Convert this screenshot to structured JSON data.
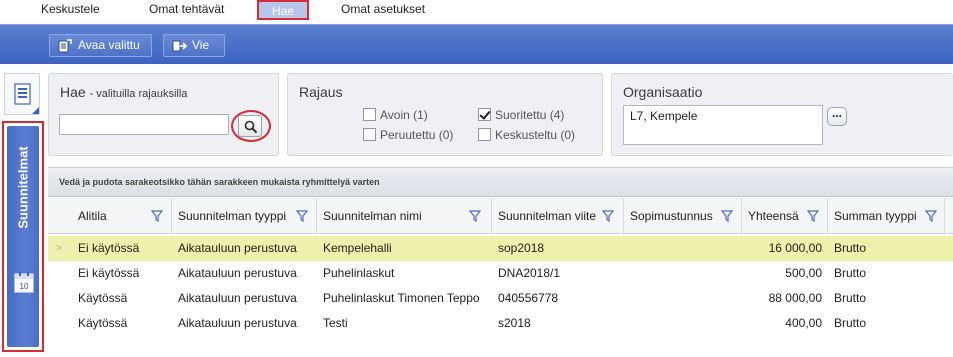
{
  "tabs": [
    {
      "label": "Keskustele",
      "active": false
    },
    {
      "label": "Omat tehtävät",
      "active": false
    },
    {
      "label": "Hae",
      "active": true
    },
    {
      "label": "Omat asetukset",
      "active": false
    }
  ],
  "toolbar": {
    "open_selected_label": "Avaa valittu",
    "export_label": "Vie"
  },
  "side": {
    "panel_label": "Suunnitelmat",
    "calendar_day": "10"
  },
  "search_panel": {
    "title": "Hae",
    "subtitle": "- valituilla rajauksilla",
    "input_value": ""
  },
  "filter_panel": {
    "title": "Rajaus",
    "options": [
      {
        "label": "Avoin (1)",
        "checked": false
      },
      {
        "label": "Suoritettu (4)",
        "checked": true
      },
      {
        "label": "Peruutettu (0)",
        "checked": false
      },
      {
        "label": "Keskusteltu (0)",
        "checked": false
      }
    ]
  },
  "org_panel": {
    "title": "Organisaatio",
    "value": "L7, Kempele",
    "more_label": "..."
  },
  "grid": {
    "group_hint": "Vedä ja pudota sarakeotsikko tähän sarakkeen mukaista ryhmittelyä varten",
    "columns": [
      "Alitila",
      "Suunnitelman tyyppi",
      "Suunnitelman nimi",
      "Suunnitelman viite",
      "Sopimustunnus",
      "Yhteensä",
      "Summan tyyppi"
    ],
    "rows": [
      {
        "alitila": "Ei käytössä",
        "tyyppi": "Aikatauluun perustuva",
        "nimi": "Kempelehalli",
        "viite": "sop2018",
        "sopimus": "",
        "yhteensa": "16 000,00",
        "summan_tyyppi": "Brutto",
        "selected": true
      },
      {
        "alitila": "Ei käytössä",
        "tyyppi": "Aikatauluun perustuva",
        "nimi": "Puhelinlaskut",
        "viite": "DNA2018/1",
        "sopimus": "",
        "yhteensa": "500,00",
        "summan_tyyppi": "Brutto",
        "selected": false
      },
      {
        "alitila": "Käytössä",
        "tyyppi": "Aikatauluun perustuva",
        "nimi": "Puhelinlaskut Timonen Teppo",
        "viite": "040556778",
        "sopimus": "",
        "yhteensa": "88 000,00",
        "summan_tyyppi": "Brutto",
        "selected": false
      },
      {
        "alitila": "Käytössä",
        "tyyppi": "Aikatauluun perustuva",
        "nimi": "Testi",
        "viite": "s2018",
        "sopimus": "",
        "yhteensa": "400,00",
        "summan_tyyppi": "Brutto",
        "selected": false
      }
    ],
    "selected_row_marker": ">"
  },
  "colors": {
    "toolbar_blue": "#4a6dc5",
    "highlight_red": "#d52b35",
    "selected_row": "#eef1ac"
  },
  "icons": [
    "document-open-icon",
    "export-icon",
    "document-list-icon",
    "calendar-icon",
    "search-icon",
    "filter-funnel-icon"
  ]
}
